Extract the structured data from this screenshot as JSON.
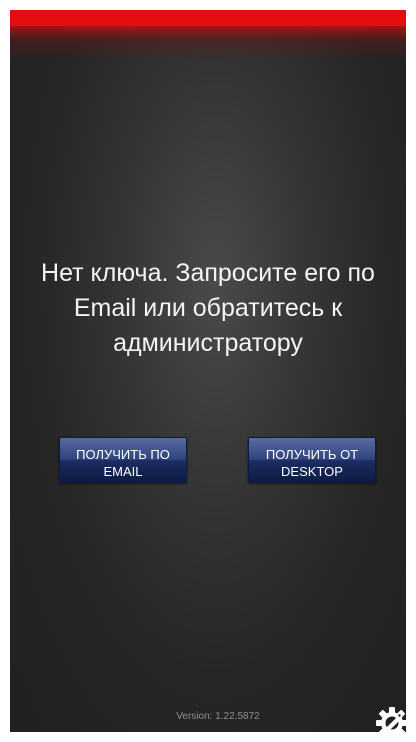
{
  "window": {
    "accent_color": "#e50d0d"
  },
  "main": {
    "message": "Нет ключа. Запросите его по Email или обратитесь к администратору"
  },
  "actions": {
    "email_button_label": "ПОЛУЧИТЬ ПО EMAIL",
    "desktop_button_label": "ПОЛУЧИТЬ ОТ DESKTOP",
    "button_color": "#1b2d62"
  },
  "footer": {
    "version": "Version: 1.22.5872",
    "settings_icon": "gear-wrench-icon"
  }
}
